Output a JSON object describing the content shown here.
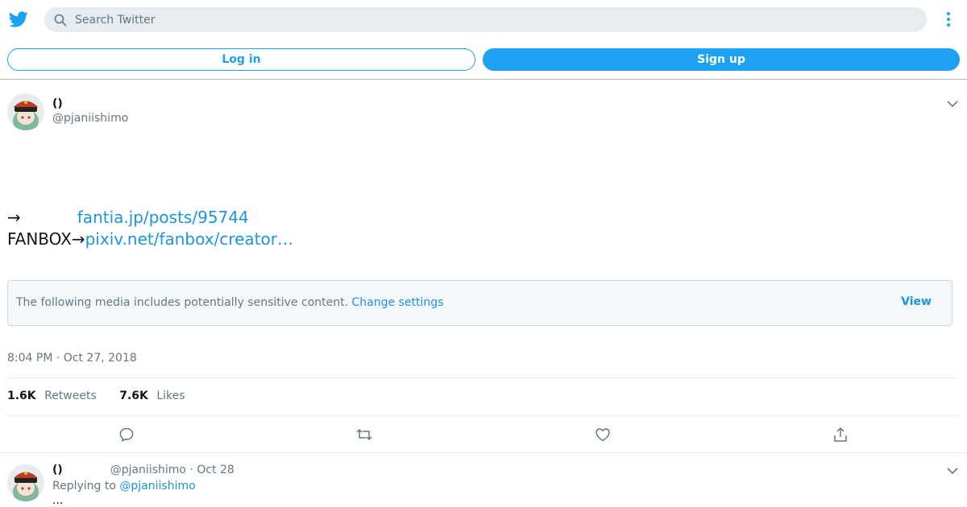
{
  "header": {
    "search_placeholder": "Search Twitter",
    "login_label": "Log in",
    "signup_label": "Sign up"
  },
  "tweet": {
    "display_name": "()",
    "handle": "@pjaniishimo",
    "line1_prefix": "→",
    "line1_link": "fantia.jp/posts/95744",
    "line2_prefix": "FANBOX→",
    "line2_link": "pixiv.net/fanbox/creator…",
    "sensitive_message": "The following media includes potentially sensitive content.",
    "change_settings": "Change settings",
    "view_label": "View",
    "timestamp": "8:04 PM · Oct 27, 2018",
    "retweets_count": "1.6K",
    "retweets_label": "Retweets",
    "likes_count": "7.6K",
    "likes_label": "Likes"
  },
  "reply": {
    "display_name": "()",
    "handle": "@pjaniishimo",
    "separator": "·",
    "date": "Oct 28",
    "replying_to_label": "Replying to",
    "replying_to_handle": "@pjaniishimo",
    "text": "..."
  },
  "colors": {
    "brand_blue": "#1da1f2",
    "link_blue": "#1b95e0",
    "muted_text": "#657786",
    "search_bg": "#e6ecf0"
  },
  "icons": [
    "twitter-bird-icon",
    "search-icon",
    "more-vertical-icon",
    "chevron-down-icon",
    "reply-icon",
    "retweet-icon",
    "like-icon",
    "share-icon"
  ]
}
